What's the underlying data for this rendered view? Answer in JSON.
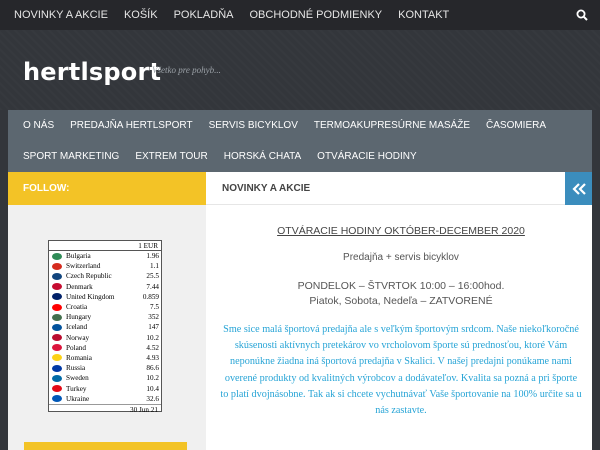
{
  "topnav": {
    "items": [
      "NOVINKY a AKCIE",
      "KOŠÍK",
      "POKLADŇA",
      "OBCHODNÉ PODMIENKY",
      "KONTAKT"
    ],
    "search_icon": "search-icon"
  },
  "header": {
    "title": "hertlsport",
    "description": "Všetko pre pohyb..."
  },
  "mainnav": {
    "items": [
      "O NÁS",
      "PREDAJŇA HERTLSPORT",
      "SERVIS BICYKLOV",
      "TERMOAKUPRESÚRNE MASÁŽE",
      "ČASOMIERA",
      "SPORT MARKETING",
      "EXTREM TOUR",
      "HORSKÁ CHATA",
      "OTVÁRACIE HODINY"
    ]
  },
  "sidebar": {
    "follow_label": "FOLLOW:",
    "currency": {
      "header": "1 EUR",
      "rows": [
        {
          "name": "Bulgaria",
          "value": "1.96",
          "color": "#2e8b57"
        },
        {
          "name": "Switzerland",
          "value": "1.1",
          "color": "#d52b1e"
        },
        {
          "name": "Czech Republic",
          "value": "25.5",
          "color": "#11457e"
        },
        {
          "name": "Denmark",
          "value": "7.44",
          "color": "#c60c30"
        },
        {
          "name": "United Kingdom",
          "value": "0.859",
          "color": "#012169"
        },
        {
          "name": "Croatia",
          "value": "7.5",
          "color": "#ff0000"
        },
        {
          "name": "Hungary",
          "value": "352",
          "color": "#436f4d"
        },
        {
          "name": "Iceland",
          "value": "147",
          "color": "#02529c"
        },
        {
          "name": "Norway",
          "value": "10.2",
          "color": "#ba0c2f"
        },
        {
          "name": "Poland",
          "value": "4.52",
          "color": "#dc143c"
        },
        {
          "name": "Romania",
          "value": "4.93",
          "color": "#fcd116"
        },
        {
          "name": "Russia",
          "value": "86.6",
          "color": "#0039a6"
        },
        {
          "name": "Sweden",
          "value": "10.2",
          "color": "#006aa7"
        },
        {
          "name": "Turkey",
          "value": "10.4",
          "color": "#e30a17"
        },
        {
          "name": "Ukraine",
          "value": "32.6",
          "color": "#0057b7"
        }
      ],
      "date": "30 Jun 21"
    }
  },
  "content": {
    "header": "NOVINKY A AKCIE",
    "title": "OTVÁRACIE HODINY OKTÓBER-DECEMBER 2020",
    "subtitle": "Predajňa + servis bicyklov",
    "hours1": "PONDELOK – ŠTVRTOK  10:00 – 16:00hod.",
    "hours2": "Piatok, Sobota, Nedeľa – ZATVORENÉ",
    "body": "Sme sice malá športová predajňa ale s veľkým športovým srdcom. Naše niekoľkoročné skúsenosti aktívnych pretekárov vo vrcholovom športe sú prednosťou, ktoré Vám neponúkne žiadna iná  športová predajňa v Skalici. V našej predajni ponúkame nami overené produkty od kvalitných výrobcov a dodávateľov. Kvalita sa pozná a pri športe to platí dvojnásobne. Tak ak si chcete vychutnávať Vaše športovanie na 100% určite sa u nás zastavte."
  },
  "colors": {
    "accent_yellow": "#f3c326",
    "accent_blue": "#3b8dbd",
    "text_blue": "#27a4d6"
  }
}
